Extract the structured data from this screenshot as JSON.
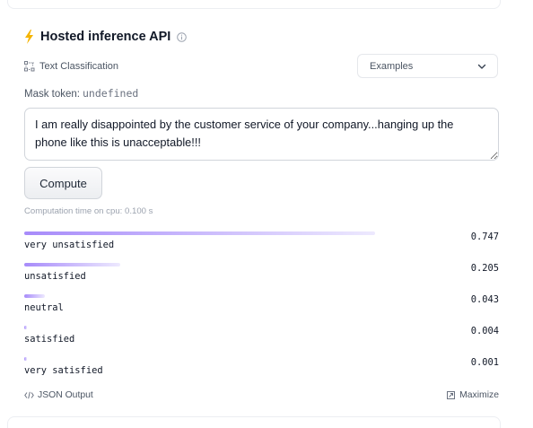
{
  "widget": {
    "title": "Hosted inference API",
    "task": {
      "label": "Text Classification",
      "icon": "text-classification-icon"
    },
    "examples_label": "Examples",
    "mask_token": {
      "label": "Mask token:",
      "value": "undefined"
    },
    "input_text": "I am really disappointed by the customer service of your company...hanging up the phone like this is unacceptable!!!",
    "compute_label": "Compute",
    "computation_time": "Computation time on cpu: 0.100 s",
    "results": [
      {
        "label": "very unsatisfied",
        "score": "0.747",
        "fraction": 0.747
      },
      {
        "label": "unsatisfied",
        "score": "0.205",
        "fraction": 0.205
      },
      {
        "label": "neutral",
        "score": "0.043",
        "fraction": 0.043
      },
      {
        "label": "satisfied",
        "score": "0.004",
        "fraction": 0.004
      },
      {
        "label": "very satisfied",
        "score": "0.001",
        "fraction": 0.001
      }
    ],
    "json_output_label": "JSON Output",
    "maximize_label": "Maximize"
  },
  "icons": {
    "bolt": "bolt-icon",
    "info": "info-icon",
    "chevron": "chevron-down-icon",
    "code": "code-icon",
    "maximize": "maximize-icon"
  },
  "colors": {
    "bolt": "#f5b400",
    "bar_start": "#a78bfa",
    "bar_end": "#ede9fe"
  }
}
